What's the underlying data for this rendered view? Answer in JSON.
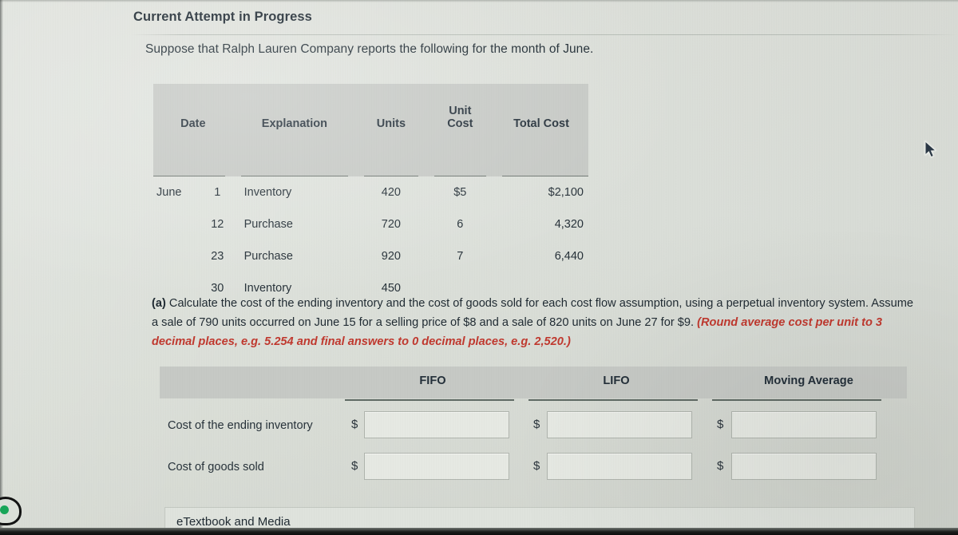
{
  "window": {
    "attempt_title": "Current Attempt in Progress",
    "prompt": "Suppose that Ralph Lauren Company reports the following for the month of June."
  },
  "inventory_table": {
    "headers": {
      "date": "Date",
      "explanation": "Explanation",
      "units": "Units",
      "unit_cost_line1": "Unit",
      "unit_cost_line2": "Cost",
      "total_cost": "Total Cost"
    },
    "rows": [
      {
        "month": "June",
        "day": "1",
        "explanation": "Inventory",
        "units": "420",
        "unit_cost": "$5",
        "total_cost": "$2,100"
      },
      {
        "month": "",
        "day": "12",
        "explanation": "Purchase",
        "units": "720",
        "unit_cost": "6",
        "total_cost": "4,320"
      },
      {
        "month": "",
        "day": "23",
        "explanation": "Purchase",
        "units": "920",
        "unit_cost": "7",
        "total_cost": "6,440"
      },
      {
        "month": "",
        "day": "30",
        "explanation": "Inventory",
        "units": "450",
        "unit_cost": "",
        "total_cost": ""
      }
    ]
  },
  "question": {
    "part_label": "(a)",
    "body": " Calculate the cost of the ending inventory and the cost of goods sold for each cost flow assumption, using a perpetual inventory system. Assume a sale of 790 units occurred on June 15 for a selling price of $8 and a sale of 820 units on June 27 for $9. ",
    "round_note": "(Round average cost per unit to 3 decimal places, e.g. 5.254 and final answers to 0 decimal places, e.g. 2,520.)",
    "round_note_color": "#c0392f"
  },
  "answers": {
    "columns": [
      "FIFO",
      "LIFO",
      "Moving Average"
    ],
    "currency_symbol": "$",
    "rows": [
      {
        "label": "Cost of the ending inventory",
        "fifo": "",
        "lifo": "",
        "moving_average": "",
        "placeholder": ""
      },
      {
        "label": "Cost of goods sold",
        "fifo": "",
        "lifo": "",
        "moving_average": "",
        "placeholder": ""
      }
    ]
  },
  "footer": {
    "etextbook_label": "eTextbook and Media"
  },
  "theme": {
    "page_background": "#dde1db",
    "header_band": "#c6c9c5",
    "text": "#1f2a32",
    "accent_red": "#c0392f",
    "field_background": "#e6e9e3",
    "field_border": "#b0b5ae"
  }
}
